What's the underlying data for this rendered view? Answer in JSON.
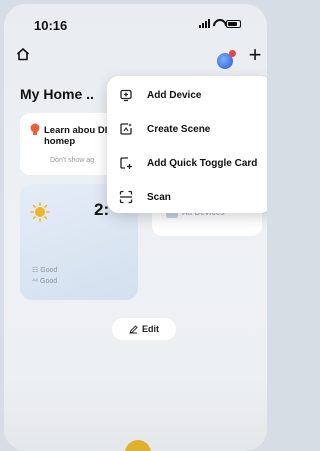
{
  "status_bar": {
    "time": "10:16"
  },
  "header": {
    "home_title": "My Home .."
  },
  "tip_card": {
    "title": "Learn abou DIY homep",
    "dismiss": "Don't show ag"
  },
  "weather": {
    "temperature": "2:",
    "metrics": [
      {
        "icon": "☷",
        "value": "Good"
      },
      {
        "icon": "⁴⁴",
        "value": "Good"
      }
    ]
  },
  "devices_card": {
    "label": "All Devices"
  },
  "edit": {
    "label": "Edit"
  },
  "menu": {
    "items": [
      {
        "label": "Add Device",
        "icon": "add-device-icon"
      },
      {
        "label": "Create Scene",
        "icon": "create-scene-icon"
      },
      {
        "label": "Add Quick Toggle Card",
        "icon": "quick-toggle-icon"
      },
      {
        "label": "Scan",
        "icon": "scan-icon"
      }
    ]
  },
  "colors": {
    "accent": "#e0b12e",
    "assistant": "#2b55d6",
    "tip_bulb": "#e8603c"
  }
}
